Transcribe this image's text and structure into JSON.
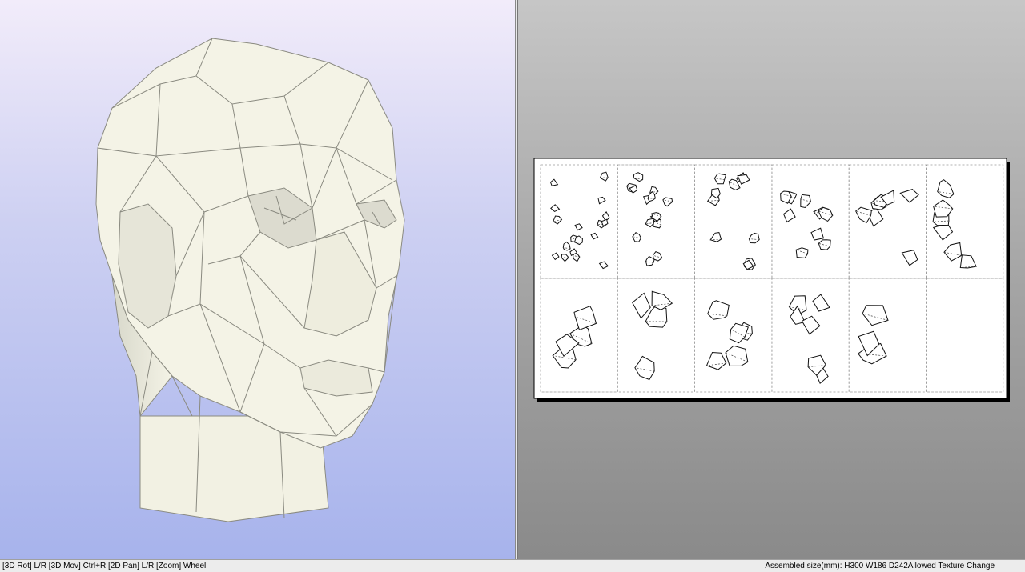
{
  "app": {
    "panels": {
      "view3d": {
        "icon": "3d-head-model"
      },
      "view2d": {
        "icon": "2d-unfolded-pattern",
        "pages": 12,
        "filled_pages": 11
      }
    }
  },
  "status_bar": {
    "hint_text": "[3D Rot] L/R [3D Mov] Ctrl+R [2D Pan] L/R [Zoom] Wheel",
    "assembled_size": "Assembled size(mm): H300 W186 D242",
    "mode": "Allowed Texture Change"
  },
  "colors": {
    "model_fill": "#f4f3e6",
    "model_edge": "#8a8a80",
    "bg3d_top": "#f2ecfa",
    "bg3d_bottom": "#a7b3ec"
  }
}
